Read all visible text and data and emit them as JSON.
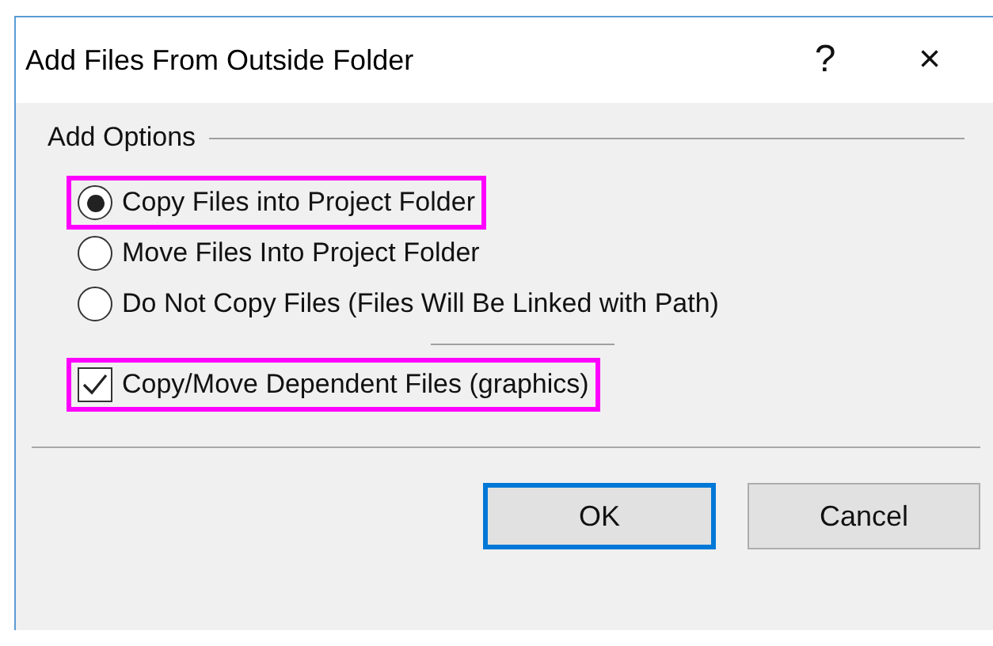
{
  "window": {
    "title": "Add Files From Outside Folder",
    "help_button": "?",
    "close_button": "×"
  },
  "group": {
    "title": "Add Options",
    "options": [
      {
        "label": "Copy Files into Project Folder",
        "selected": true,
        "highlighted": true
      },
      {
        "label": "Move Files Into Project Folder",
        "selected": false,
        "highlighted": false
      },
      {
        "label": "Do Not Copy Files (Files Will Be Linked with Path)",
        "selected": false,
        "highlighted": false
      }
    ],
    "checkbox": {
      "label": "Copy/Move Dependent Files (graphics)",
      "checked": true,
      "highlighted": true
    }
  },
  "buttons": [
    {
      "label": "OK",
      "default": true
    },
    {
      "label": "Cancel",
      "default": false
    }
  ]
}
